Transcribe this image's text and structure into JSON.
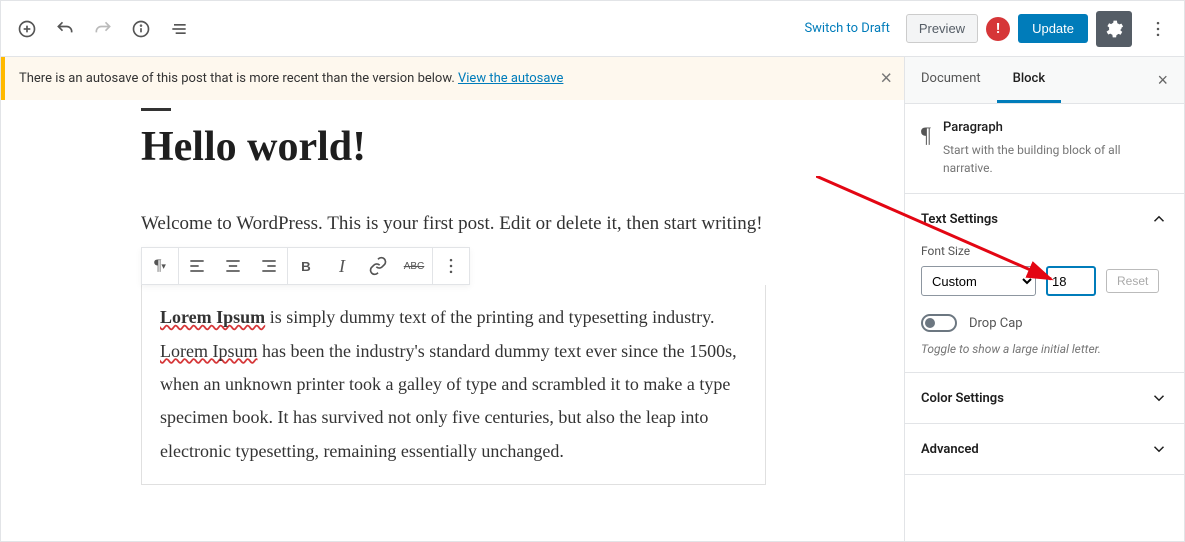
{
  "toolbar": {
    "switch_to_draft": "Switch to Draft",
    "preview": "Preview",
    "update": "Update"
  },
  "notice": {
    "text": "There is an autosave of this post that is more recent than the version below. ",
    "link": "View the autosave"
  },
  "post": {
    "title": "Hello world!",
    "welcome": "Welcome to WordPress. This is your first post. Edit or delete it, then start writing!"
  },
  "block": {
    "lorem_strong": "Lorem Ipsum",
    "p1": " is simply dummy text of the printing and  typesetting industry. ",
    "lorem2": "Lorem Ipsum",
    "p2": " has been the industry's standard dummy  text ever since the 1500s, when an unknown printer took a galley of  type and scrambled it to make a type specimen book. It has survived not  only five centuries, but also the leap into electronic typesetting,  remaining essentially unchanged."
  },
  "sidebar": {
    "tab_document": "Document",
    "tab_block": "Block",
    "block_title": "Paragraph",
    "block_desc": "Start with the building block of all narrative.",
    "text_settings": "Text Settings",
    "font_size_label": "Font Size",
    "font_size_select": "Custom",
    "font_size_value": "18",
    "reset": "Reset",
    "drop_cap": "Drop Cap",
    "drop_cap_help": "Toggle to show a large initial letter.",
    "color_settings": "Color Settings",
    "advanced": "Advanced"
  }
}
